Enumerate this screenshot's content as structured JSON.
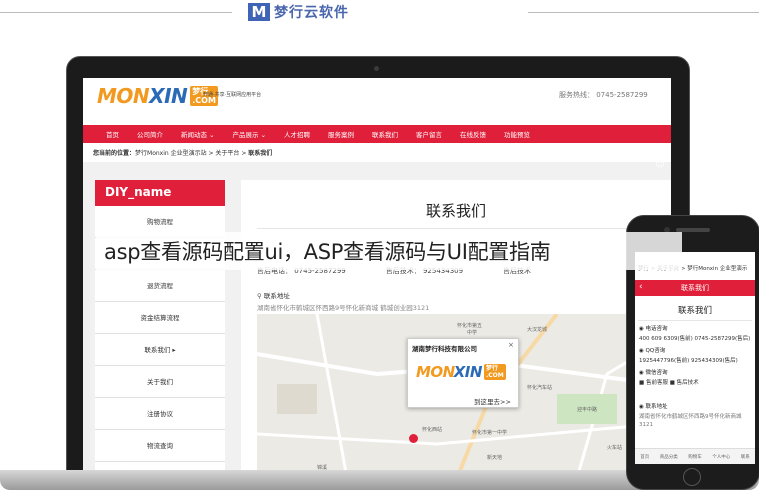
{
  "brand": {
    "mark": "M",
    "text": "梦行云软件"
  },
  "site": {
    "logo": {
      "part1": "MON",
      "part2": "XIN",
      "badge": "梦行",
      "sub": ".COM"
    },
    "slogan": "开通·共享·互联网应用平台",
    "phone": "服务热线： 0745-2587299",
    "nav": [
      "首页",
      "公司简介",
      "新闻动态 ⌄",
      "产品展示 ⌄",
      "人才招聘",
      "服务案例",
      "联系我们",
      "客户留言",
      "在线反馈",
      "功能预览"
    ],
    "breadcrumb": {
      "prefix": "您当前的位置：",
      "path": "梦行Monxin 企业型演示站 > 关于平台 > ",
      "current": "联系我们"
    }
  },
  "sidebar": {
    "title": "DIY_name",
    "items": [
      "购物流程",
      "",
      "退货流程",
      "资金结算流程",
      "联系我们 ▸",
      "关于我们",
      "注册协议",
      "物流查询"
    ]
  },
  "content": {
    "title": "联系我们",
    "after_sales_phone": "售后电话： 0745-2587299",
    "after_sales_tech": "售后技术： 925434309",
    "after_sales_label": "售后技术",
    "address_label": "联系地址",
    "address_value": "湖南省怀化市鹤城区怀西路9号怀化新商城 鹤城创业园3121",
    "map": {
      "popup_title": "湖南梦行科技有限公司",
      "popup_close": "×",
      "popup_go": "到这里去>>",
      "labels": [
        "怀化市第五",
        "中学",
        "怀化市第一",
        "怀化汽车站",
        "大汉龙城",
        "怀化西站",
        "锦溪",
        "新天地",
        "怀化市第一中学",
        "火车站",
        "锦东",
        "迎丰中路"
      ]
    }
  },
  "phone": {
    "breadcrumb": "梦行 > 关于平台 > 梦行Monxin 企业型演示",
    "bar_title": "联系我们",
    "back": "‹",
    "page_title": "联系我们",
    "lines": [
      "◉ 电话咨询",
      "400 609 6309(售前)   0745-2587299(售后)",
      "◉ QQ咨询",
      "1925447796(售前)   925434309(售后)",
      "◉ 微信咨询",
      "■ 售前客服        ■ 售后技术",
      "◉ 联系地址",
      "湖南省怀化市鹤城区怀西路9号怀化新商城",
      "3121"
    ],
    "footer": [
      "首页",
      "商品分类",
      "购物车",
      "个人中心",
      "联系"
    ]
  },
  "headline": "asp查看源码配置ui，ASP查看源码与UI配置指南",
  "colors": {
    "accent": "#e0203a",
    "logo_orange": "#f29a1f",
    "logo_blue": "#2a6ab7",
    "brand_blue": "#4a67ad"
  },
  "icons": [
    "chat-icon",
    "message-icon",
    "qr-icon",
    "phone-icon",
    "map-pin-icon",
    "close-icon",
    "back-arrow-icon"
  ]
}
